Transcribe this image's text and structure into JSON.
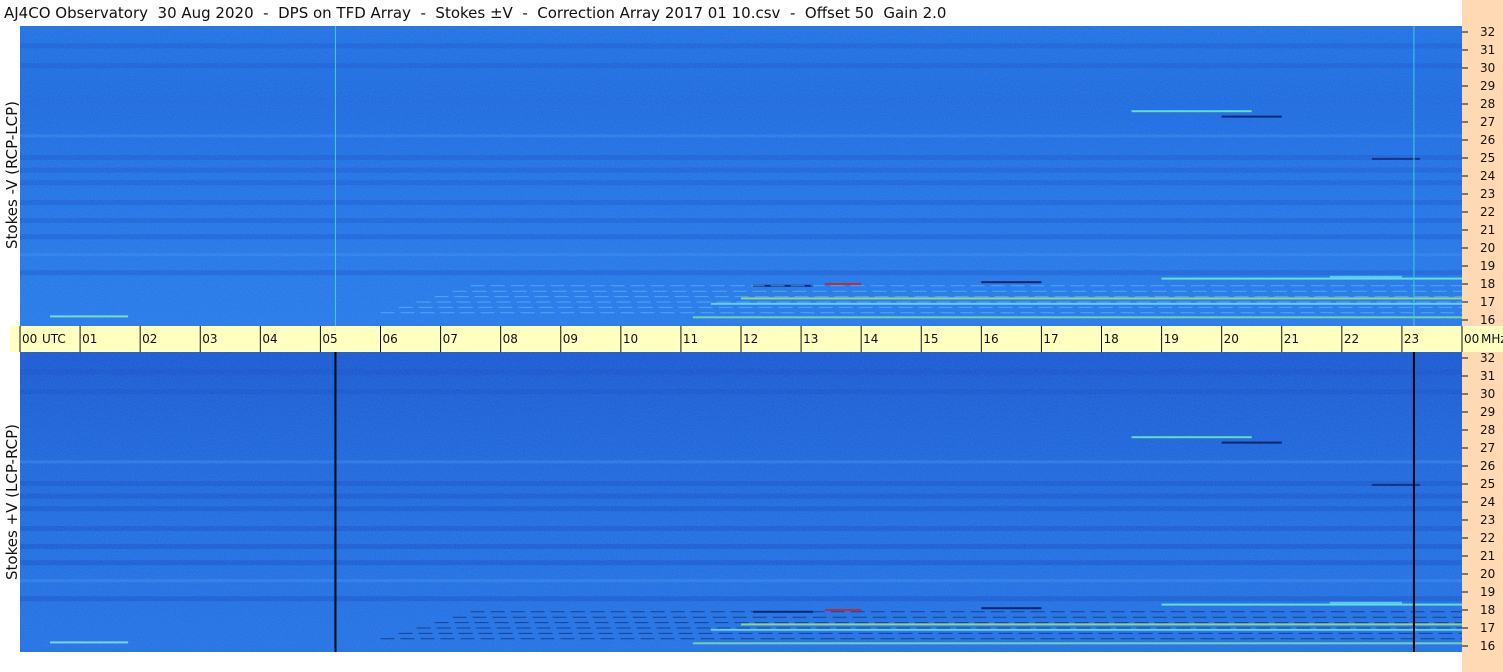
{
  "title": "AJ4CO Observatory  30 Aug 2020  -  DPS on TFD Array  -  Stokes ±V  -  Correction Array 2017 01 10.csv  -  Offset 50  Gain 2.0",
  "colors": {
    "background": "#ffffff",
    "axis_band": "#ffffc0",
    "freq_band": "#ffd8b4",
    "spectrogram_base": "#1f73e6",
    "spectrogram_dark": "#1558cf",
    "marker_top": "#3cd2c8",
    "marker_bottom": "#000000"
  },
  "chart_data": [
    {
      "type": "heatmap",
      "panel": "top",
      "ylabel": "Stokes -V (RCP-LCP)",
      "y_tick_labels": [
        "32",
        "31",
        "30",
        "29",
        "28",
        "27",
        "26",
        "25",
        "24",
        "23",
        "22",
        "21",
        "20",
        "19",
        "18",
        "17",
        "16"
      ],
      "ylim": [
        16,
        32
      ],
      "y_unit": "MHz",
      "xlim": [
        0,
        24
      ],
      "vertical_markers_utc": [
        5.25,
        23.2
      ]
    },
    {
      "type": "heatmap",
      "panel": "bottom",
      "ylabel": "Stokes +V (LCP-RCP)",
      "y_tick_labels": [
        "32",
        "31",
        "30",
        "29",
        "28",
        "27",
        "26",
        "25",
        "24",
        "23",
        "22",
        "21",
        "20",
        "19",
        "18",
        "17",
        "16"
      ],
      "ylim": [
        16,
        32
      ],
      "y_unit": "MHz",
      "xlim": [
        0,
        24
      ],
      "vertical_markers_utc": [
        5.25,
        23.2
      ]
    }
  ],
  "time_axis": {
    "unit": "UTC",
    "first_label": "00",
    "tick_labels": [
      "01",
      "02",
      "03",
      "04",
      "05",
      "06",
      "07",
      "08",
      "09",
      "10",
      "11",
      "12",
      "13",
      "14",
      "15",
      "16",
      "17",
      "18",
      "19",
      "20",
      "21",
      "22",
      "23"
    ],
    "last_label": "00",
    "corner_label": "MHz"
  }
}
